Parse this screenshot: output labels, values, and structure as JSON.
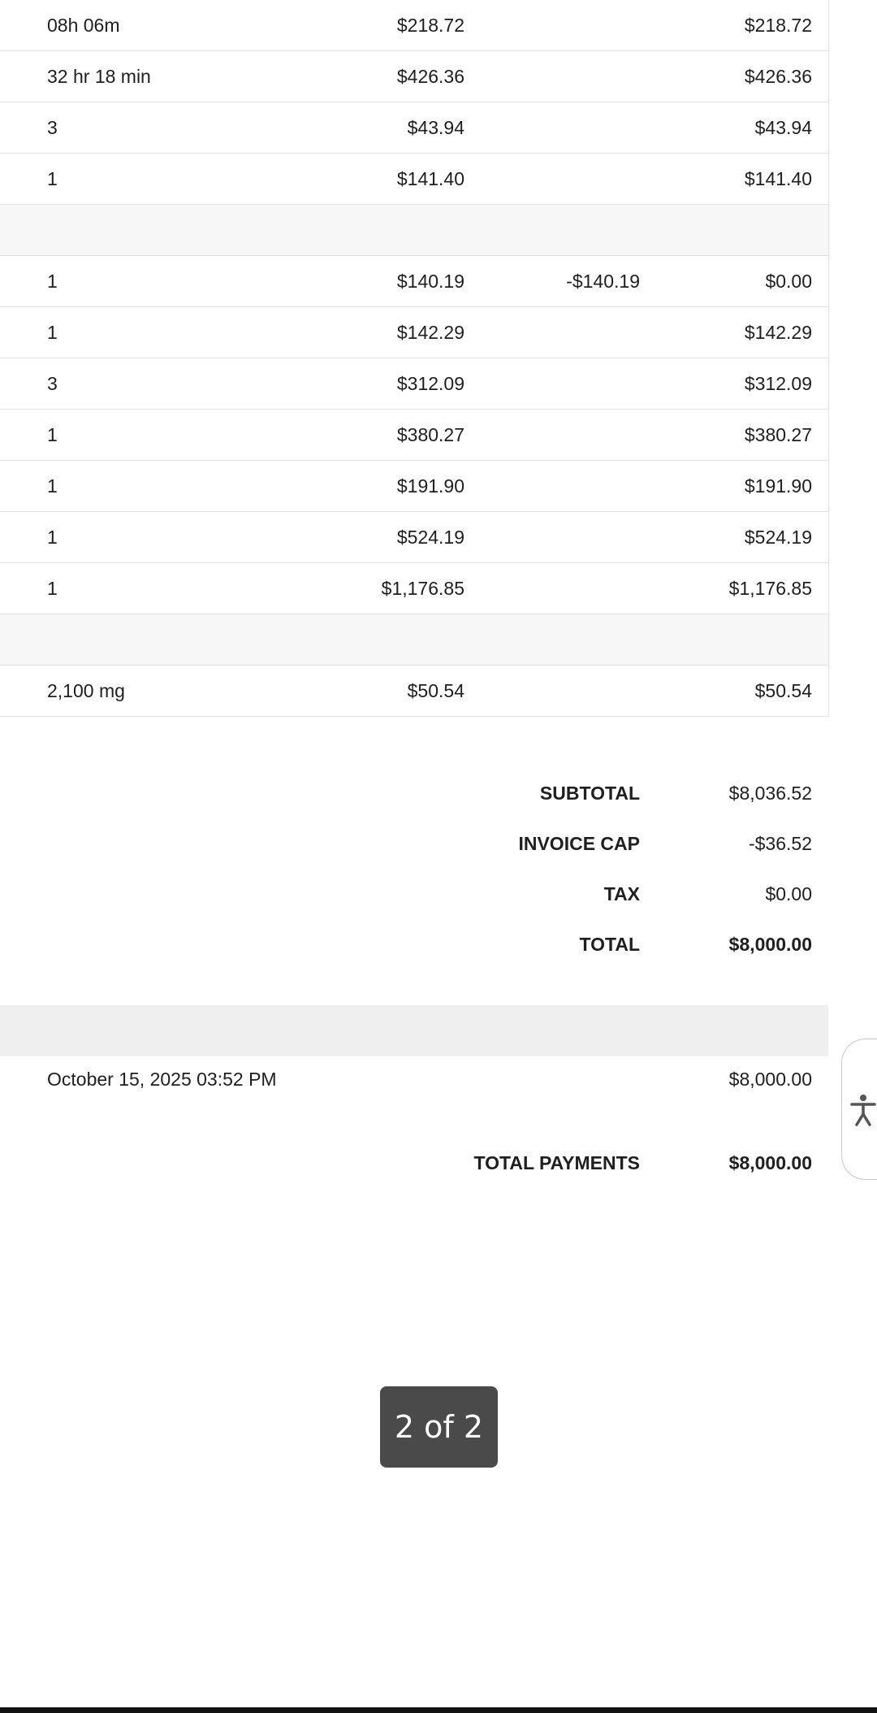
{
  "line_items": [
    {
      "qty": "08h 06m",
      "price": "$218.72",
      "adjustment": "",
      "amount": "$218.72"
    },
    {
      "qty": "32 hr 18 min",
      "price": "$426.36",
      "adjustment": "",
      "amount": "$426.36"
    },
    {
      "qty": "3",
      "price": "$43.94",
      "adjustment": "",
      "amount": "$43.94"
    },
    {
      "qty": "1",
      "price": "$141.40",
      "adjustment": "",
      "amount": "$141.40"
    },
    {
      "qty": "",
      "price": "",
      "adjustment": "",
      "amount": ""
    },
    {
      "qty": "1",
      "price": "$140.19",
      "adjustment": "-$140.19",
      "amount": "$0.00"
    },
    {
      "qty": "1",
      "price": "$142.29",
      "adjustment": "",
      "amount": "$142.29"
    },
    {
      "qty": "3",
      "price": "$312.09",
      "adjustment": "",
      "amount": "$312.09"
    },
    {
      "qty": "1",
      "price": "$380.27",
      "adjustment": "",
      "amount": "$380.27"
    },
    {
      "qty": "1",
      "price": "$191.90",
      "adjustment": "",
      "amount": "$191.90"
    },
    {
      "qty": "1",
      "price": "$524.19",
      "adjustment": "",
      "amount": "$524.19"
    },
    {
      "qty": "1",
      "price": "$1,176.85",
      "adjustment": "",
      "amount": "$1,176.85"
    },
    {
      "qty": "",
      "price": "",
      "adjustment": "",
      "amount": ""
    },
    {
      "qty": "2,100 mg",
      "price": "$50.54",
      "adjustment": "",
      "amount": "$50.54"
    }
  ],
  "totals": {
    "subtotal_label": "SUBTOTAL",
    "subtotal_value": "$8,036.52",
    "cap_label": "INVOICE CAP",
    "cap_value": "-$36.52",
    "tax_label": "TAX",
    "tax_value": "$0.00",
    "total_label": "TOTAL",
    "total_value": "$8,000.00"
  },
  "payments": {
    "date": "October 15, 2025 03:52 PM",
    "amount": "$8,000.00",
    "total_label": "TOTAL PAYMENTS",
    "total_value": "$8,000.00"
  },
  "pager": {
    "label": "2 of 2"
  },
  "accessibility": {
    "icon": "accessibility-icon"
  },
  "colors": {
    "row_border": "#e2e2e2",
    "blank_row_bg": "#f7f7f7",
    "payments_header_bg": "#efefef",
    "pager_bg": "#4a4a4a"
  }
}
